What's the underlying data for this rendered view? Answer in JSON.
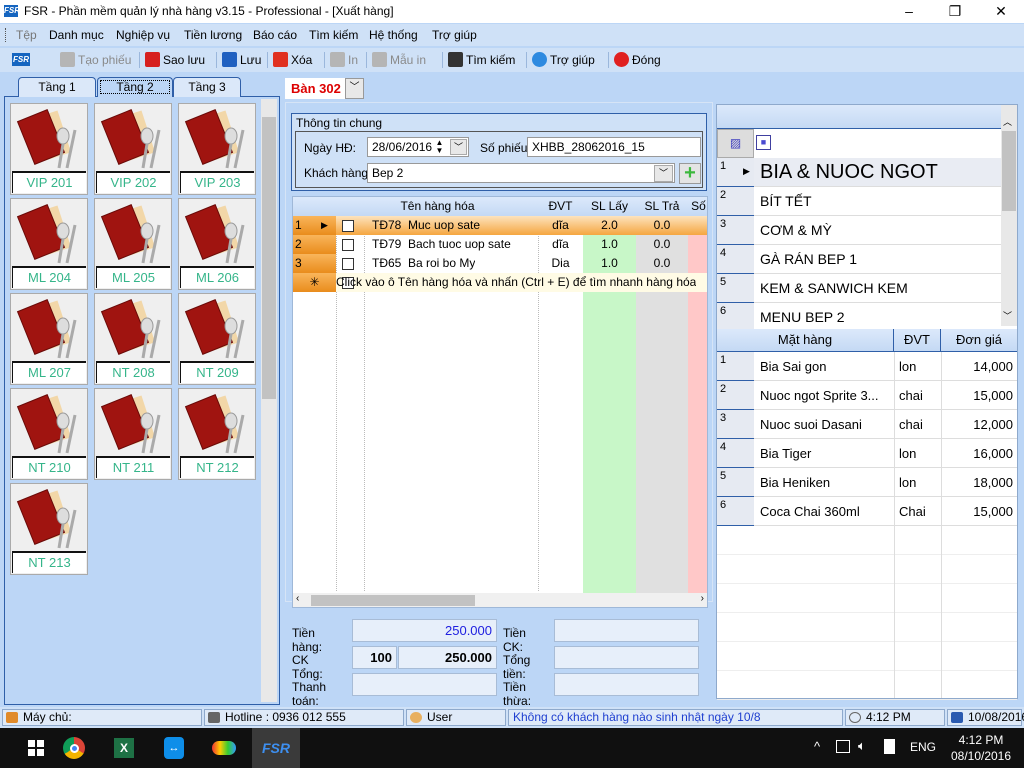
{
  "window": {
    "title": "FSR - Phần mềm quản lý nhà hàng v3.15 - Professional - [Xuất hàng]",
    "logo": "FSR",
    "minimize": "–",
    "maximize": "❐",
    "close": "✕"
  },
  "menu": [
    "Tệp",
    "Danh mục",
    "Nghiệp vụ",
    "Tiền lương",
    "Báo cáo",
    "Tìm kiếm",
    "Hệ thống",
    "Trợ giúp"
  ],
  "toolbar": [
    {
      "label": "Tạo phiếu",
      "icon": "pencil-icon",
      "enabled": false,
      "color": "#b5b5b5"
    },
    {
      "label": "Sao lưu",
      "icon": "copy-icon",
      "enabled": true,
      "color": "#d62020"
    },
    {
      "label": "Lưu",
      "icon": "save-icon",
      "enabled": true,
      "color": "#2060c0"
    },
    {
      "label": "Xóa",
      "icon": "delete-icon",
      "enabled": true,
      "color": "#e03020"
    },
    {
      "label": "In",
      "icon": "print-icon",
      "enabled": false,
      "color": "#b5b5b5"
    },
    {
      "label": "Mẫu in",
      "icon": "template-icon",
      "enabled": false,
      "color": "#b5b5b5"
    },
    {
      "label": "Tìm kiếm",
      "icon": "binoculars-icon",
      "enabled": true,
      "color": "#333333"
    },
    {
      "label": "Trợ giúp",
      "icon": "help-icon",
      "enabled": true,
      "color": "#2e8ae0"
    },
    {
      "label": "Đóng",
      "icon": "close-circle-icon",
      "enabled": true,
      "color": "#e02020"
    }
  ],
  "floor_tabs": [
    {
      "label": "Tầng 1"
    },
    {
      "label": "Tầng 2",
      "active": true
    },
    {
      "label": "Tầng 3"
    }
  ],
  "tables": [
    "VIP 201",
    "VIP 202",
    "VIP 203",
    "ML 204",
    "ML 205",
    "ML 206",
    "ML 207",
    "NT 208",
    "NT 209",
    "NT 210",
    "NT 211",
    "NT 212",
    "NT 213"
  ],
  "order": {
    "table_name": "Bàn 302",
    "group_title": "Thông tin chung",
    "date_label": "Ngày HĐ:",
    "date_value": "28/06/2016",
    "slip_label": "Số phiếu:",
    "slip_value": "XHBB_28062016_15",
    "customer_label": "Khách hàng:",
    "customer_value": "Bep 2",
    "columns": [
      "Tên hàng hóa",
      "ĐVT",
      "SL Lấy",
      "SL Trả",
      "Số"
    ],
    "rows": [
      {
        "num": "1",
        "code": "TĐ78",
        "name": "Muc uop sate",
        "unit": "dĩa",
        "qty_take": "2.0",
        "qty_return": "0.0"
      },
      {
        "num": "2",
        "code": "TĐ79",
        "name": "Bach tuoc uop  sate",
        "unit": "dĩa",
        "qty_take": "1.0",
        "qty_return": "0.0"
      },
      {
        "num": "3",
        "code": "TĐ65",
        "name": "Ba roi bo My",
        "unit": "Dia",
        "qty_take": "1.0",
        "qty_return": "0.0"
      }
    ],
    "new_row_symbol": "✳",
    "new_row_hint": "Click vào ô Tên hàng hóa và nhấn (Ctrl + E) để tìm nhanh hàng hóa"
  },
  "totals": {
    "goods_label": "Tiền hàng:",
    "goods_value": "250.000",
    "discount_label": "CK Tổng:",
    "discount_pct": "100",
    "discount_value": "250.000",
    "payment_label": "Thanh toán:",
    "ck_label": "Tiền CK:",
    "total_label": "Tổng tiền:",
    "change_label": "Tiền thừa:"
  },
  "categories": [
    "BIA & NUOC NGOT",
    "BÍT TẾT",
    "CƠM & MỲ",
    "GÀ RÁN BEP 1",
    "KEM & SANWICH KEM",
    "MENU BEP 2"
  ],
  "products": {
    "columns": [
      "Mặt hàng",
      "ĐVT",
      "Đơn giá"
    ],
    "rows": [
      {
        "name": "Bia Sai gon",
        "unit": "lon",
        "price": "14,000"
      },
      {
        "name": "Nuoc ngot Sprite 3...",
        "unit": "chai",
        "price": "15,000"
      },
      {
        "name": "Nuoc suoi Dasani",
        "unit": "chai",
        "price": "12,000"
      },
      {
        "name": "Bia Tiger",
        "unit": "lon",
        "price": "16,000"
      },
      {
        "name": "Bia Heniken",
        "unit": "lon",
        "price": "18,000"
      },
      {
        "name": "Coca Chai 360ml",
        "unit": "Chai",
        "price": "15,000"
      }
    ]
  },
  "status": {
    "server": "Máy chủ:",
    "hotline": "Hotline : 0936 012 555",
    "user": "User",
    "message": "Không có khách hàng nào sinh nhật ngày 10/8",
    "time": "4:12 PM",
    "date": "10/08/2016"
  },
  "taskbar": {
    "time": "4:12 PM",
    "date": "08/10/2016",
    "lang": "ENG",
    "apps": [
      "windows-start-icon",
      "chrome-icon",
      "excel-icon",
      "teamviewer-icon",
      "app-icon",
      "fsr-icon"
    ]
  },
  "colors": {
    "accent": "#2f5fa8",
    "row_selected": "#f5a640",
    "qty_take_bg": "#c8f7c8",
    "qty_return_bg": "#e0e0e0",
    "qty_extra_bg": "#ffc8c8",
    "table_label": "#35b58a",
    "status_message": "#1f3fd0"
  }
}
